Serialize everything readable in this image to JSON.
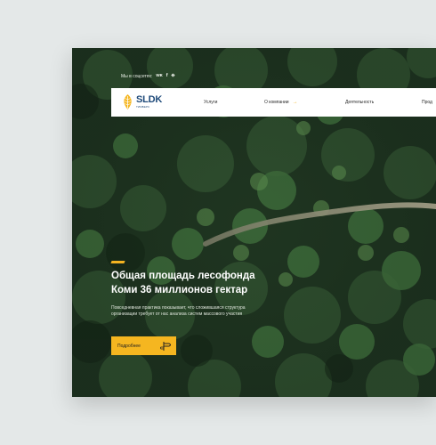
{
  "social": {
    "label": "Мы в соцсетях:",
    "icons": [
      "vk-icon",
      "facebook-icon",
      "ok-icon"
    ],
    "vk_glyph": "ᴡᴋ",
    "fb_glyph": "f",
    "ok_glyph": "ꝋ"
  },
  "header": {
    "logo": {
      "main": "SLDK",
      "sub": "ТИМБЕРС"
    },
    "nav": [
      {
        "label": "Услуги"
      },
      {
        "label": "О компании"
      },
      {
        "label": "Деятельность"
      },
      {
        "label": "Прод"
      }
    ]
  },
  "hero": {
    "title_line1": "Общая площадь лесофонда",
    "title_line2": "Коми 36 миллионов гектар",
    "text_line1": "Повседневная практика показывает, что сложившаяся структура",
    "text_line2": "организации требует от нас анализа систем массового участия",
    "cta_label": "Подробнее"
  },
  "colors": {
    "accent": "#f5b620",
    "brand": "#1f4a7a",
    "forest_dark": "#1d3020"
  }
}
